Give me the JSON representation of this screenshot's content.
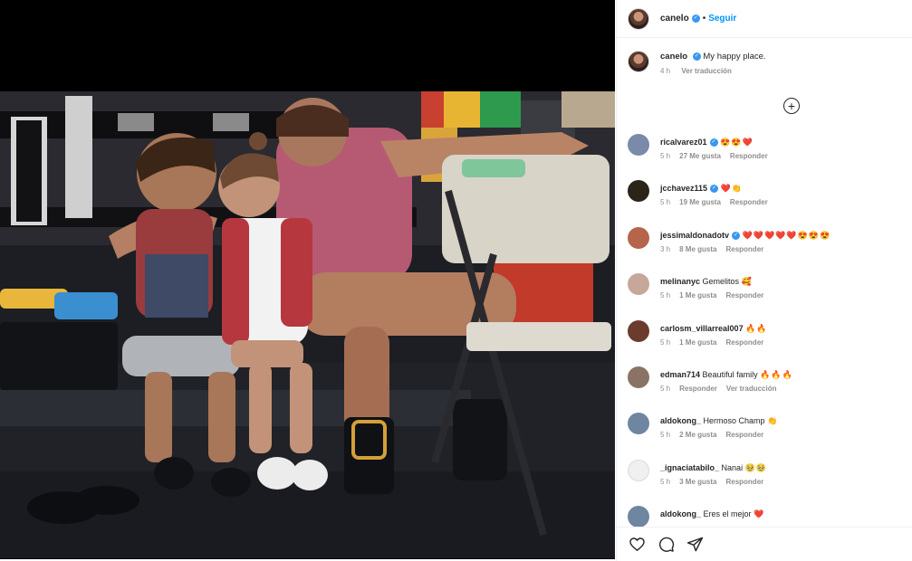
{
  "post": {
    "username": "canelo",
    "follow_label": "Seguir",
    "separator": "•"
  },
  "caption": {
    "username": "canelo",
    "text": "My happy place.",
    "time": "4 h",
    "translate": "Ver traducción"
  },
  "load_more_symbol": "+",
  "comments": [
    {
      "user": "ricalvarez01",
      "verified": true,
      "text": "",
      "emoji": "😍😍❤️",
      "time": "5 h",
      "likes": "27 Me gusta",
      "reply": "Responder",
      "translate": "",
      "avatar_color": "#7a8aa8"
    },
    {
      "user": "jcchavez115",
      "verified": true,
      "text": "",
      "emoji": "❤️👏",
      "time": "5 h",
      "likes": "19 Me gusta",
      "reply": "Responder",
      "translate": "",
      "avatar_color": "#2b2418"
    },
    {
      "user": "jessimaldonadotv",
      "verified": true,
      "text": "",
      "emoji": "❤️❤️❤️❤️❤️😍😍😍",
      "time": "3 h",
      "likes": "8 Me gusta",
      "reply": "Responder",
      "translate": "",
      "avatar_color": "#b5654a"
    },
    {
      "user": "melinanyc",
      "verified": false,
      "text": "Gemelitos",
      "emoji": "🥰",
      "time": "5 h",
      "likes": "1 Me gusta",
      "reply": "Responder",
      "translate": "",
      "avatar_color": "#c7a79a"
    },
    {
      "user": "carlosm_villarreal007",
      "verified": false,
      "text": "",
      "emoji": "🔥🔥",
      "time": "5 h",
      "likes": "1 Me gusta",
      "reply": "Responder",
      "translate": "",
      "avatar_color": "#6b3b2e"
    },
    {
      "user": "edman714",
      "verified": false,
      "text": "Beautiful family",
      "emoji": "🔥🔥🔥",
      "time": "5 h",
      "likes": "",
      "reply": "Responder",
      "translate": "Ver traducción",
      "avatar_color": "#8a7364"
    },
    {
      "user": "aldokong_",
      "verified": false,
      "text": "Hermoso Champ",
      "emoji": "👏",
      "time": "5 h",
      "likes": "2 Me gusta",
      "reply": "Responder",
      "translate": "",
      "avatar_color": "#6e86a0"
    },
    {
      "user": "_ignaciatabilo_",
      "verified": false,
      "text": "Nanai",
      "emoji": "🥹🥹",
      "time": "5 h",
      "likes": "3 Me gusta",
      "reply": "Responder",
      "translate": "",
      "avatar_color": "#f0f0f0"
    },
    {
      "user": "aldokong_",
      "verified": false,
      "text": "Eres el mejor",
      "emoji": "❤️",
      "time": "",
      "likes": "",
      "reply": "",
      "translate": "",
      "avatar_color": "#6e86a0"
    }
  ],
  "icons": {
    "like": "heart-icon",
    "comment": "comment-icon",
    "share": "share-icon",
    "load_more": "plus-circle-icon"
  },
  "colors": {
    "follow_blue": "#0095f6",
    "verified_blue": "#3897f0",
    "muted": "#8e8e8e"
  }
}
